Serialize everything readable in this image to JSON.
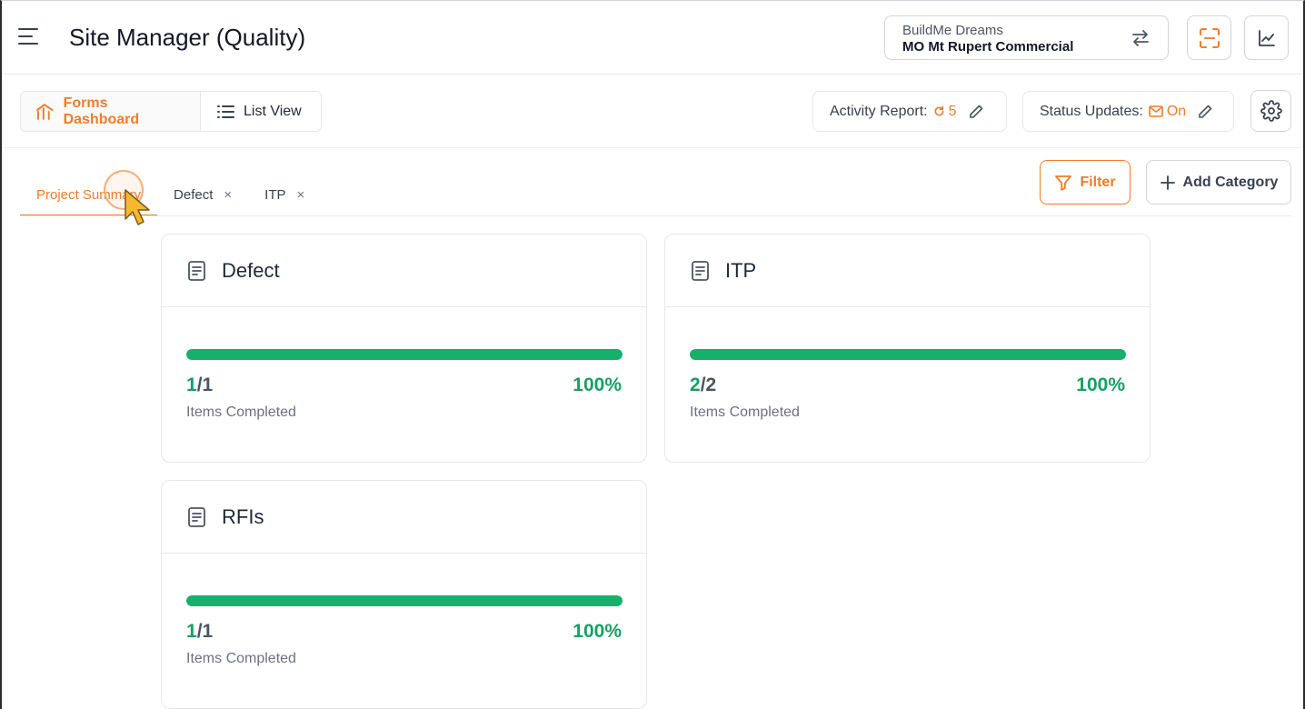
{
  "header": {
    "title": "Site Manager (Quality)",
    "org_name": "BuildMe Dreams",
    "project_name": "MO Mt Rupert Commercial"
  },
  "toolbar": {
    "forms_dashboard_label": "Forms Dashboard",
    "list_view_label": "List View",
    "activity_report_label": "Activity Report:",
    "activity_report_value": "5",
    "status_updates_label": "Status Updates:",
    "status_updates_value": "On"
  },
  "tabs": [
    {
      "label": "Project Summary",
      "active": true
    },
    {
      "label": "Defect",
      "close": "×"
    },
    {
      "label": "ITP",
      "close": "×"
    }
  ],
  "actions": {
    "filter_label": "Filter",
    "add_category_label": "Add Category"
  },
  "cards": [
    {
      "title": "Defect",
      "done": "1",
      "total": "/1",
      "percent": "100%",
      "progress": 1.0,
      "caption": "Items Completed"
    },
    {
      "title": "ITP",
      "done": "2",
      "total": "/2",
      "percent": "100%",
      "progress": 1.0,
      "caption": "Items Completed"
    },
    {
      "title": "RFIs",
      "done": "1",
      "total": "/1",
      "percent": "100%",
      "progress": 1.0,
      "caption": "Items Completed"
    }
  ],
  "colors": {
    "accent": "#f47b2a",
    "success": "#16b06a"
  }
}
